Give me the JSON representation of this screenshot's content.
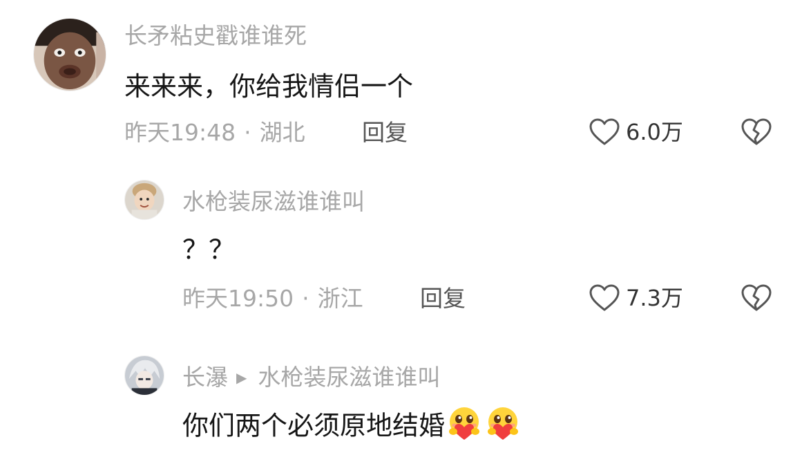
{
  "comments": [
    {
      "username": "长矛粘史戳谁谁死",
      "text": "来来来，你给我情侣一个",
      "time": "昨天19:48",
      "location": "湖北",
      "separator": "·",
      "reply_label": "回复",
      "likes": "6.0万",
      "avatar_icon": "avatar-photo-face"
    },
    {
      "username": "水枪装尿滋谁谁叫",
      "text": "？？",
      "time": "昨天19:50",
      "location": "浙江",
      "separator": "·",
      "reply_label": "回复",
      "likes": "7.3万",
      "avatar_icon": "avatar-photo-child"
    },
    {
      "username": "长瀑",
      "reply_to": "水枪装尿滋谁谁叫",
      "reply_arrow_icon": "triangle-right-icon",
      "text": "你们两个必须原地结婚",
      "avatar_icon": "avatar-photo-anime",
      "emojis": [
        "hugging-heart-emoji",
        "hugging-heart-emoji"
      ]
    }
  ],
  "icons": {
    "like": "heart-outline-icon",
    "dislike": "broken-heart-icon"
  },
  "colors": {
    "text": "#161616",
    "meta": "#a7a7a7",
    "reply": "#555555",
    "background": "#ffffff"
  }
}
